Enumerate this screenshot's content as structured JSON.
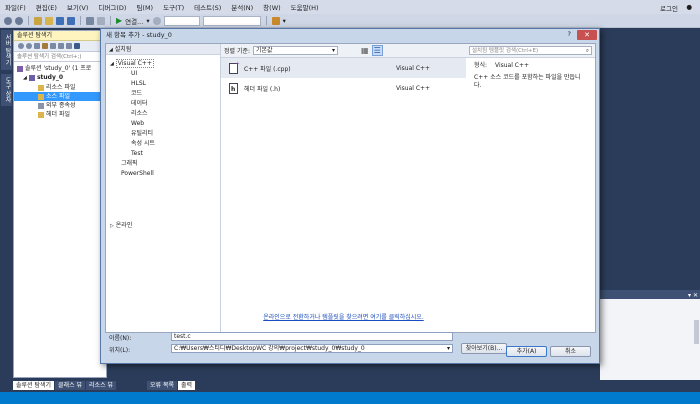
{
  "menubar": {
    "items": [
      "파일(F)",
      "편집(E)",
      "보기(V)",
      "디버그(D)",
      "팀(M)",
      "도구(T)",
      "테스트(S)",
      "분석(N)",
      "창(W)",
      "도움말(H)"
    ],
    "login": "로그인"
  },
  "toolbar": {
    "run_label": "연결..."
  },
  "sidetabs": {
    "server_explorer": "서버 탐색기",
    "toolbox": "도구 상자"
  },
  "solution_explorer": {
    "title": "솔루션 탐색기",
    "search_placeholder": "솔루션 탐색기 검색(Ctrl+;)",
    "tree": [
      {
        "label": "솔루션 'study_0' (1 프로",
        "level": 0
      },
      {
        "label": "study_0",
        "level": 1
      },
      {
        "label": "리소스 파일",
        "level": 2
      },
      {
        "label": "소스 파일",
        "level": 2,
        "selected": true
      },
      {
        "label": "외부 종속성",
        "level": 2
      },
      {
        "label": "헤더 파일",
        "level": 2
      }
    ],
    "bottom_tabs": [
      "솔루션 탐색기",
      "클래스 뷰",
      "리소스 뷰"
    ]
  },
  "output_tabs": [
    "오류 목록",
    "출력"
  ],
  "dialog": {
    "title": "새 항목 추가 - study_0",
    "help": "?",
    "close": "✕",
    "installed_header": "설치됨",
    "categories": [
      {
        "label": "Visual C++",
        "level": 0,
        "expanded": true,
        "selected": true
      },
      {
        "label": "UI",
        "level": 1
      },
      {
        "label": "HLSL",
        "level": 1
      },
      {
        "label": "코드",
        "level": 1
      },
      {
        "label": "데이터",
        "level": 1
      },
      {
        "label": "리소스",
        "level": 1
      },
      {
        "label": "Web",
        "level": 1
      },
      {
        "label": "유틸리티",
        "level": 1
      },
      {
        "label": "속성 시트",
        "level": 1
      },
      {
        "label": "Test",
        "level": 1
      },
      {
        "label": "그래픽",
        "level": 0
      },
      {
        "label": "PowerShell",
        "level": 0
      }
    ],
    "online_label": "온라인",
    "sort_label": "정렬 기준:",
    "sort_value": "기본값",
    "templates": [
      {
        "name": "C++ 파일 (.cpp)",
        "type": "Visual C++",
        "selected": true
      },
      {
        "name": "헤더 파일 (.h)",
        "type": "Visual C++",
        "selected": false
      }
    ],
    "online_link": "온라인으로 전환하거나 템플릿을 찾으려면 여기를 클릭하십시오.",
    "search_placeholder": "설치됨 템플릿 검색(Ctrl+E)",
    "info_type_label": "형식:",
    "info_type_value": "Visual C++",
    "info_desc": "C++ 소스 코드를 포함하는 파일을 만듭니다.",
    "name_label": "이름(N):",
    "name_value": "test.c",
    "location_label": "위치(L):",
    "location_value": "C:₩Users₩스티디₩DesktopWC 강의₩project₩study_0₩study_0",
    "browse_button": "찾아보기(B)...",
    "add_button": "추가(A)",
    "cancel_button": "취소"
  }
}
